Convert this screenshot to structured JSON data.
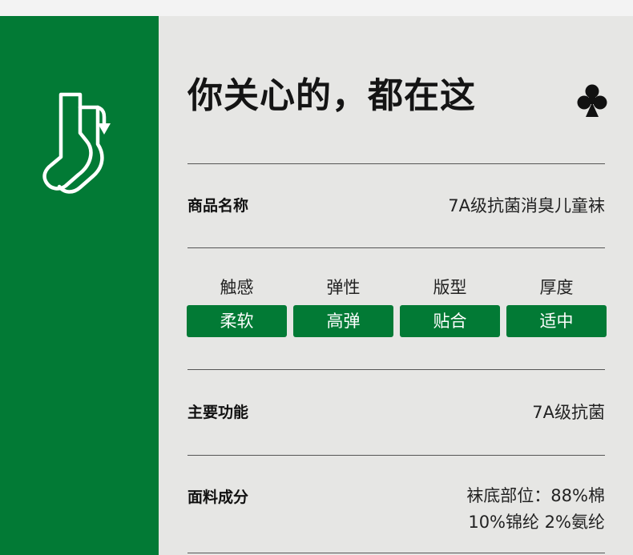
{
  "header": {
    "title": "你关心的，都在这"
  },
  "icons": {
    "left": "sock-recycle-icon",
    "right": "club-icon"
  },
  "colors": {
    "brand_green": "#027a35",
    "background": "#e6e6e4",
    "badge_text": "#ffffff"
  },
  "product_name": {
    "label": "商品名称",
    "value": "7A级抗菌消臭儿童袜"
  },
  "attributes": [
    {
      "name": "触感",
      "value": "柔软"
    },
    {
      "name": "弹性",
      "value": "高弹"
    },
    {
      "name": "版型",
      "value": "贴合"
    },
    {
      "name": "厚度",
      "value": "适中"
    }
  ],
  "main_function": {
    "label": "主要功能",
    "value": "7A级抗菌"
  },
  "fabric": {
    "label": "面料成分",
    "value_line1": "袜底部位：88%棉",
    "value_line2": "10%锦纶 2%氨纶"
  }
}
